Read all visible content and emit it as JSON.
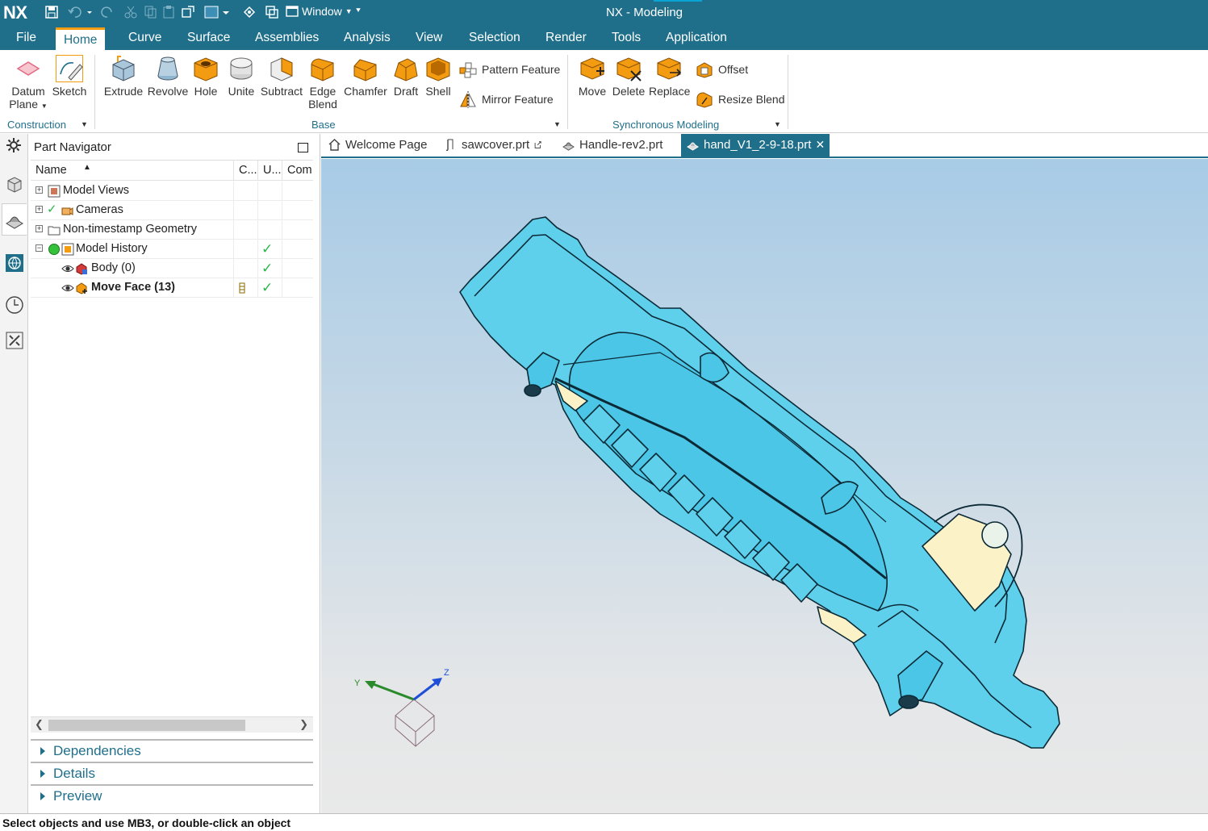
{
  "app": {
    "logo": "NX",
    "title": "NX - Modeling",
    "window_menu": "Window"
  },
  "menubar": {
    "items": [
      "File",
      "Home",
      "Curve",
      "Surface",
      "Assemblies",
      "Analysis",
      "View",
      "Selection",
      "Render",
      "Tools",
      "Application"
    ],
    "active": "Home"
  },
  "ribbon": {
    "construction": {
      "label": "Construction",
      "datum_plane_line1": "Datum",
      "datum_plane_line2": "Plane",
      "sketch": "Sketch"
    },
    "base": {
      "label": "Base",
      "extrude": "Extrude",
      "revolve": "Revolve",
      "hole": "Hole",
      "unite": "Unite",
      "subtract": "Subtract",
      "edge_blend_line1": "Edge",
      "edge_blend_line2": "Blend",
      "chamfer": "Chamfer",
      "draft": "Draft",
      "shell": "Shell",
      "pattern_feature": "Pattern Feature",
      "mirror_feature": "Mirror Feature"
    },
    "synchronous": {
      "label": "Synchronous Modeling",
      "move": "Move",
      "delete": "Delete",
      "replace": "Replace",
      "offset": "Offset",
      "resize_blend": "Resize Blend"
    }
  },
  "navigator": {
    "title": "Part Navigator",
    "columns": [
      "Name",
      "C...",
      "U...",
      "Com"
    ],
    "rows": [
      {
        "label": "Model Views",
        "expander": "+",
        "bold": false
      },
      {
        "label": "Cameras",
        "expander": "+",
        "bold": false
      },
      {
        "label": "Non-timestamp Geometry",
        "expander": "+",
        "bold": false
      },
      {
        "label": "Model History",
        "expander": "−",
        "bold": false,
        "up_to_date": true
      },
      {
        "label": "Body (0)",
        "bold": false,
        "up_to_date": true
      },
      {
        "label": "Move Face (13)",
        "bold": true,
        "up_to_date": true
      }
    ],
    "panels": [
      "Dependencies",
      "Details",
      "Preview"
    ]
  },
  "tabs": [
    {
      "label": "Welcome Page",
      "icon": "home-icon"
    },
    {
      "label": "sawcover.prt",
      "icon": "part-icon"
    },
    {
      "label": "Handle-rev2.prt",
      "icon": "part-icon"
    },
    {
      "label": "hand_V1_2-9-18.prt",
      "icon": "part-icon",
      "active": true
    }
  ],
  "triad": {
    "x": "",
    "y": "Y",
    "z": "Z"
  },
  "status": {
    "message": "Select objects and use MB3, or double-click an object"
  },
  "colors": {
    "brand": "#1f6f8b",
    "model_face": "#5fd0ec",
    "model_edge": "#0b2a36",
    "highlight": "#f39c12",
    "check": "#27b84a"
  }
}
